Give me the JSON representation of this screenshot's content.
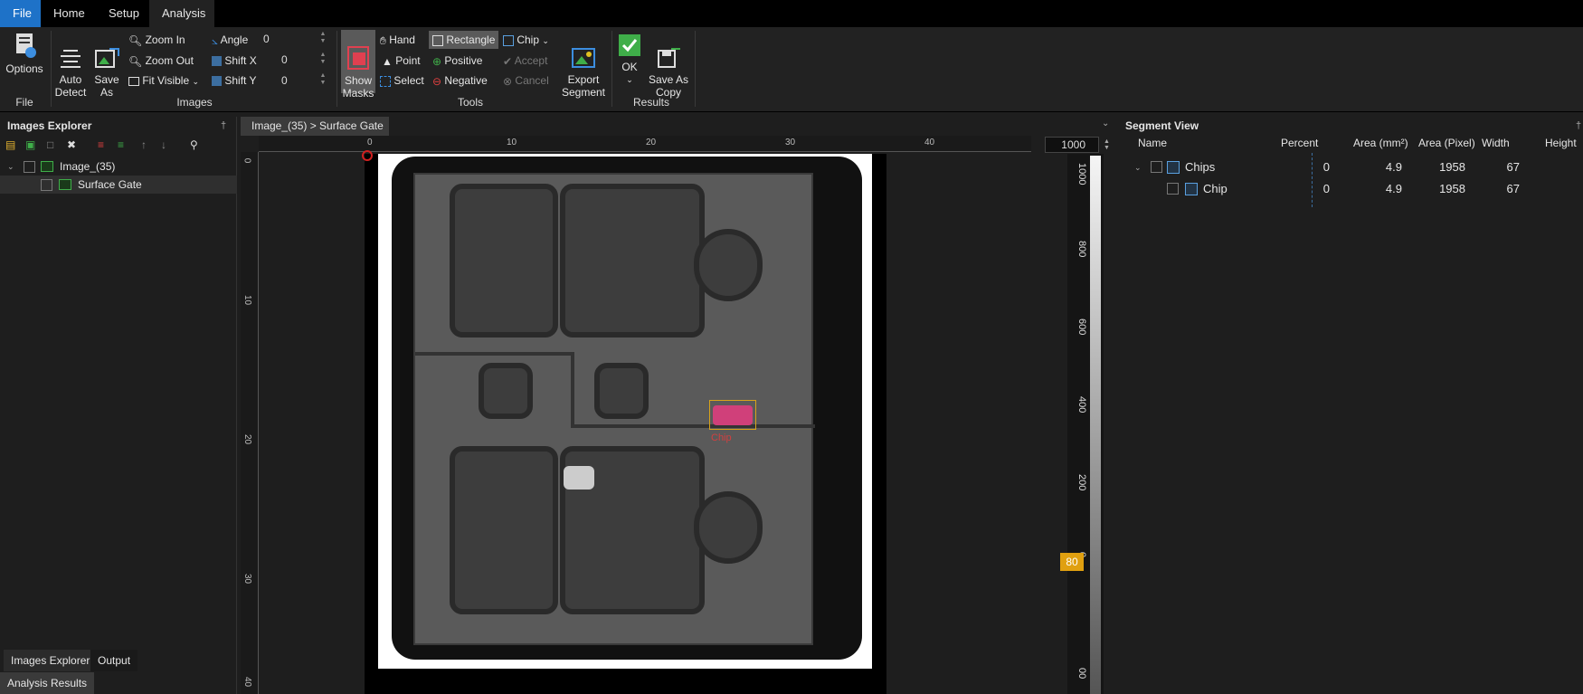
{
  "menu": {
    "tabs": [
      "File",
      "Home",
      "Setup",
      "Analysis"
    ]
  },
  "ribbon": {
    "options": "Options",
    "auto_detect": "Auto\nDetect",
    "save_as": "Save\nAs",
    "zoom_in": "Zoom In",
    "zoom_out": "Zoom Out",
    "fit_visible": "Fit Visible",
    "angle": {
      "label": "Angle",
      "value": "0"
    },
    "shift_x": {
      "label": "Shift X",
      "value": "0"
    },
    "shift_y": {
      "label": "Shift Y",
      "value": "0"
    },
    "show_masks": "Show\nMasks",
    "hand": "Hand",
    "point": "Point",
    "select": "Select",
    "rectangle": "Rectangle",
    "positive": "Positive",
    "negative": "Negative",
    "chip": "Chip",
    "accept": "Accept",
    "cancel": "Cancel",
    "export_segment": "Export\nSegment",
    "ok": "OK",
    "save_as_copy": "Save As\nCopy",
    "groups": {
      "file": "File",
      "images": "Images",
      "tools": "Tools",
      "results": "Results"
    }
  },
  "left_panel": {
    "title": "Images Explorer",
    "tree": [
      {
        "label": "Image_(35)"
      },
      {
        "label": "Surface Gate"
      }
    ],
    "bottom_tabs": [
      "Images Explorer",
      "Output"
    ],
    "analysis_tab": "Analysis Results"
  },
  "document": {
    "tab": "Image_(35) > Surface Gate",
    "hruler_ticks": [
      "0",
      "10",
      "20",
      "30",
      "40"
    ],
    "vruler_ticks": [
      "0",
      "10",
      "20",
      "30",
      "40"
    ],
    "segment_label": "Chip"
  },
  "zoom": {
    "value": "1000",
    "labels": [
      "1000",
      "800",
      "600",
      "400",
      "200",
      "0",
      "00"
    ],
    "thumb": "80"
  },
  "segment_view": {
    "title": "Segment View",
    "columns": [
      "Name",
      "Percent",
      "Area (mm²)",
      "Area (Pixel)",
      "Width",
      "Height"
    ],
    "rows": [
      {
        "name": "Chips",
        "percent": "0",
        "area_mm": "4.9",
        "area_px": "1958",
        "width": "67"
      },
      {
        "name": "Chip",
        "percent": "0",
        "area_mm": "4.9",
        "area_px": "1958",
        "width": "67"
      }
    ]
  },
  "colors": {
    "file_tab": "#1e72c8",
    "segment_mask": "#d0407a",
    "segment_box": "#d8a31a",
    "zoom_thumb": "#e0a010",
    "ok_green": "#3fae49"
  }
}
